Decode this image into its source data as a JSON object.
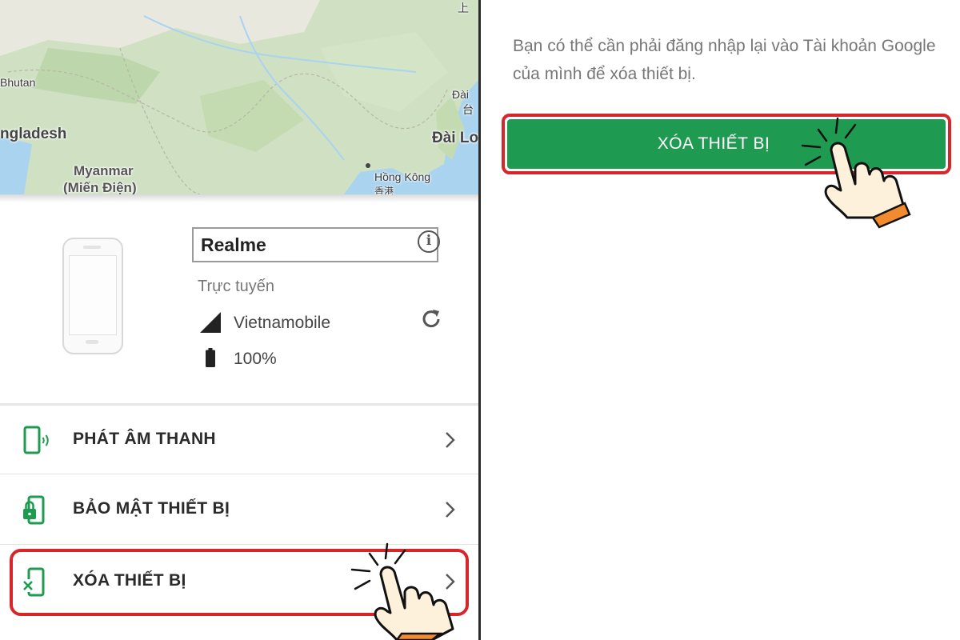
{
  "map": {
    "labels": {
      "bhutan": "Bhutan",
      "bangladesh": "ngladesh",
      "myanmar": "Myanmar",
      "mien_dien": "(Miến Điện)",
      "dai_top": "Đài",
      "dai_han": "台",
      "dai_loan": "Đài Lo",
      "hong_kong": "Hồng Kông",
      "hong_kong_han": "香港",
      "top_right": "上"
    }
  },
  "device": {
    "name": "Realme",
    "status": "Trực tuyến",
    "carrier": "Vietnamobile",
    "battery": "100%"
  },
  "menu": [
    {
      "label": "PHÁT ÂM THANH"
    },
    {
      "label": "BẢO MẬT THIẾT BỊ"
    },
    {
      "label": "XÓA THIẾT BỊ"
    }
  ],
  "right": {
    "message": "Bạn có thể cần phải đăng nhập lại vào Tài khoản Google của mình để xóa thiết bị.",
    "erase_button": "XÓA THIẾT BỊ"
  },
  "colors": {
    "accent_green": "#1e9b50",
    "highlight_red": "#d6262a",
    "map_land": "#cfe0c3",
    "map_water": "#a9d3ee"
  },
  "icons": [
    "info-icon",
    "signal-icon",
    "refresh-icon",
    "battery-icon",
    "ring-phone-icon",
    "lock-phone-icon",
    "erase-phone-icon",
    "chevron-right-icon",
    "pointing-hand-icon"
  ]
}
